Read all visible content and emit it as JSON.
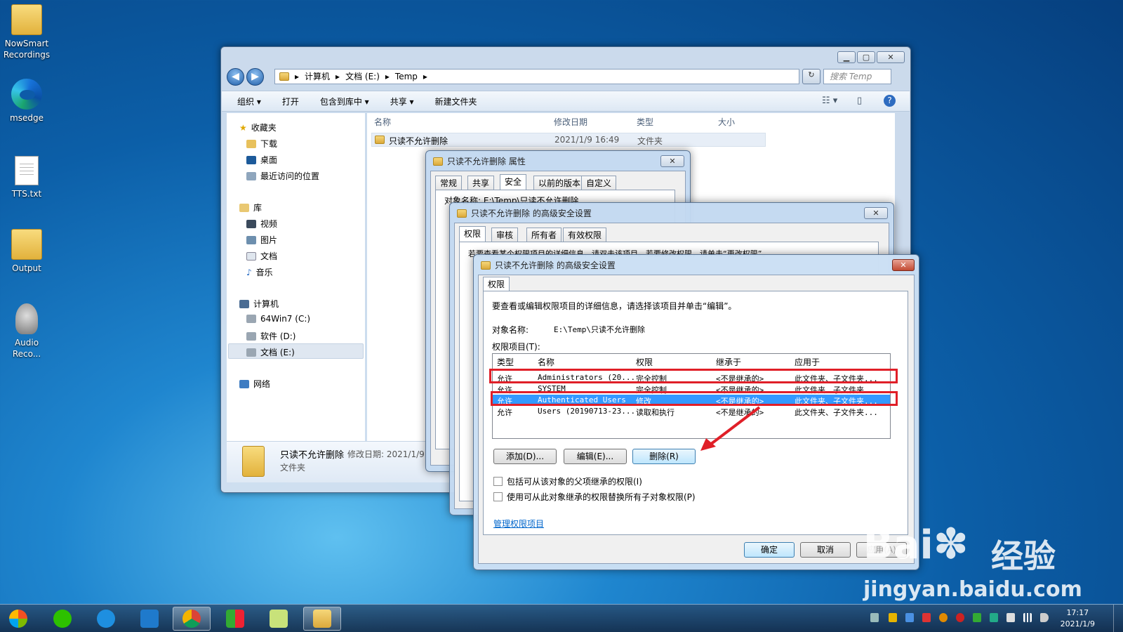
{
  "desktop": {
    "icons": [
      {
        "label": "NowSmart\nRecordings",
        "icon": "folder-icon"
      },
      {
        "label": "msedge",
        "icon": "edge-icon"
      },
      {
        "label": "TTS.txt",
        "icon": "text-file-icon"
      },
      {
        "label": "Output",
        "icon": "folder-icon"
      },
      {
        "label": "Audio\nReco...",
        "icon": "microphone-icon"
      }
    ]
  },
  "explorer": {
    "breadcrumb": [
      "计算机",
      "文档 (E:)",
      "Temp"
    ],
    "search_placeholder": "搜索 Temp",
    "toolbar": [
      "组织 ▾",
      "打开",
      "包含到库中 ▾",
      "共享 ▾",
      "新建文件夹"
    ],
    "nav": {
      "favorites": "收藏夹",
      "fav_items": [
        "下载",
        "桌面",
        "最近访问的位置"
      ],
      "library": "库",
      "lib_items": [
        "视频",
        "图片",
        "文档",
        "音乐"
      ],
      "computer": "计算机",
      "drives": [
        "64Win7 (C:)",
        "软件 (D:)",
        "文档 (E:)"
      ],
      "network": "网络"
    },
    "columns": [
      "名称",
      "修改日期",
      "类型",
      "大小"
    ],
    "file": {
      "name": "只读不允许删除",
      "date": "2021/1/9 16:49",
      "type": "文件夹"
    },
    "details": {
      "name": "只读不允许删除",
      "date_label": "修改日期: 2021/1/9",
      "type": "文件夹"
    }
  },
  "props_dialog": {
    "title": "只读不允许删除 属性",
    "tabs": [
      "常规",
      "共享",
      "安全",
      "以前的版本",
      "自定义"
    ],
    "object_line": "对象名称:    E:\\Temp\\只读不允许删除"
  },
  "adv_dialog": {
    "title": "只读不允许删除 的高级安全设置",
    "tabs": [
      "权限",
      "审核",
      "所有者",
      "有效权限"
    ],
    "info": "若要查看某个权限项目的详细信息，请双击该项目。若要修改权限，请单击“更改权限”。"
  },
  "edit_dialog": {
    "title": "只读不允许删除 的高级安全设置",
    "tab": "权限",
    "info": "要查看或编辑权限项目的详细信息，请选择该项目并单击“编辑”。",
    "object_label": "对象名称:",
    "object_value": "E:\\Temp\\只读不允许删除",
    "entries_label": "权限项目(T):",
    "list_headers": [
      "类型",
      "名称",
      "权限",
      "继承于",
      "应用于"
    ],
    "rows": [
      [
        "允许",
        "Administrators (20...",
        "完全控制",
        "<不是继承的>",
        "此文件夹、子文件夹..."
      ],
      [
        "允许",
        "SYSTEM",
        "完全控制",
        "<不是继承的>",
        "此文件夹、子文件夹..."
      ],
      [
        "允许",
        "Authenticated Users",
        "修改",
        "<不是继承的>",
        "此文件夹、子文件夹..."
      ],
      [
        "允许",
        "Users (20190713-23...",
        "读取和执行",
        "<不是继承的>",
        "此文件夹、子文件夹..."
      ]
    ],
    "selected_row": 2,
    "buttons": {
      "add": "添加(D)...",
      "edit": "编辑(E)...",
      "remove": "删除(R)"
    },
    "check1": "包括可从该对象的父项继承的权限(I)",
    "check2": "使用可从此对象继承的权限替换所有子对象权限(P)",
    "manage_link": "管理权限项目",
    "ok": "确定",
    "cancel": "取消",
    "apply": "应用(A)"
  },
  "taskbar": {
    "apps": [
      "start-orb",
      "wechat-icon",
      "ie-icon",
      "vscode-icon",
      "chrome-icon",
      "app-icon",
      "notepad-icon",
      "explorer-icon"
    ],
    "time": "17:17",
    "date": "2021/1/9"
  },
  "watermark": {
    "brand": "Bai",
    "cn": "经验",
    "url": "jingyan.baidu.com"
  },
  "colors": {
    "highlight": "#3399ff",
    "annotation": "#e01f28"
  }
}
